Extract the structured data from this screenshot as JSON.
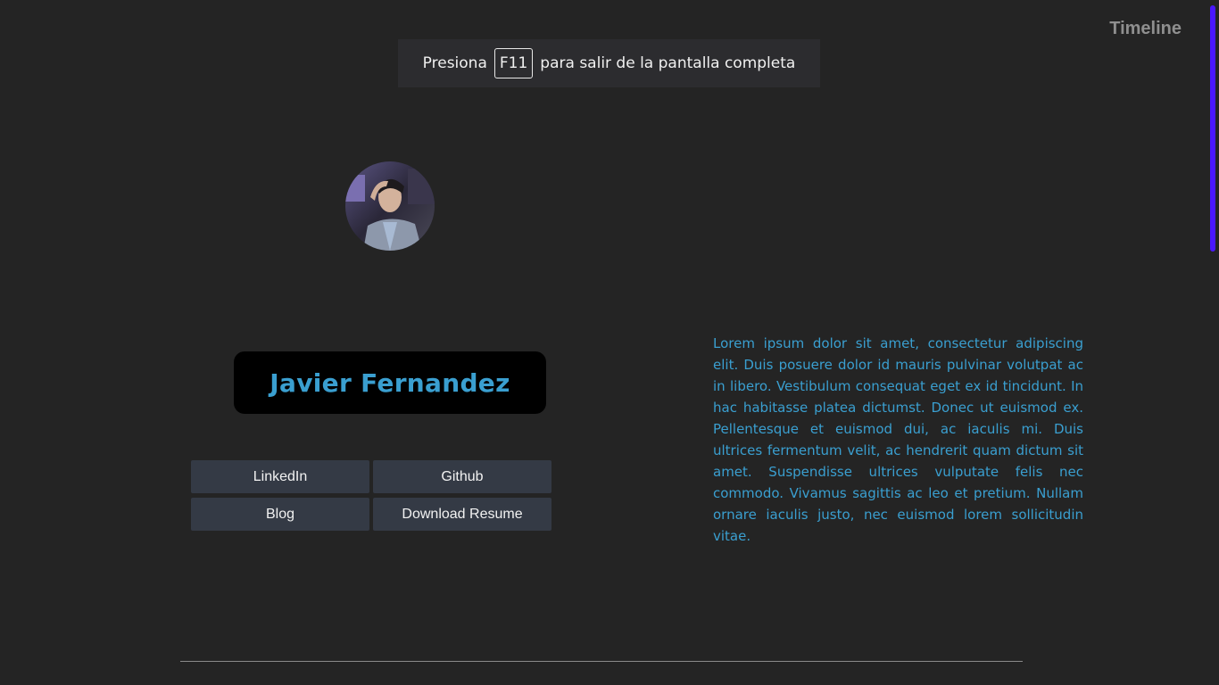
{
  "fullscreen_notice": {
    "prefix": "Presiona",
    "key": "F11",
    "suffix": "para salir de la pantalla completa"
  },
  "nav": {
    "timeline_label": "Timeline"
  },
  "profile": {
    "name": "Javier Fernandez",
    "avatar_icon": "profile-photo"
  },
  "links": [
    {
      "label": "LinkedIn"
    },
    {
      "label": "Github"
    },
    {
      "label": "Blog"
    },
    {
      "label": "Download Resume"
    }
  ],
  "bio": "Lorem ipsum dolor sit amet, consectetur adipiscing elit. Duis posuere dolor id mauris pulvinar volutpat ac in libero. Vestibulum consequat eget ex id tincidunt. In hac habitasse platea dictumst. Donec ut euismod ex. Pellentesque et euismod dui, ac iaculis mi. Duis ultrices fermentum velit, ac hendrerit quam dictum sit amet. Suspendisse ultrices vulputate felis nec commodo. Vivamus sagittis ac leo et pretium. Nullam ornare iaculis justo, nec euismod lorem sollicitudin vitae.",
  "colors": {
    "background": "#242424",
    "accent": "#3a9fd0",
    "scrollbar": "#4a17ff",
    "button": "#343a45"
  }
}
